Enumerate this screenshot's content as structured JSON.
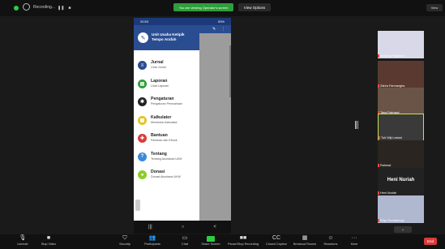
{
  "topbar": {
    "recording_label": "Recording...",
    "pause_icon": "pause-icon",
    "stop_icon": "stop-icon",
    "share_banner": "You are viewing Operator's screen",
    "view_options": "View Options",
    "view_button": "View"
  },
  "phone": {
    "status_time": "20:53",
    "status_right": "53%",
    "drawer": {
      "title": "Unit Usaha Ketipik Tempo Arafah",
      "items": [
        {
          "title": "Jurnal",
          "sub": "Lihat Jurnal",
          "color": "#2a4d92",
          "icon": "journal-icon",
          "glyph": "≡"
        },
        {
          "title": "Laporan",
          "sub": "Lihat Laporan",
          "color": "#2e9e3b",
          "icon": "report-icon",
          "glyph": "▤"
        },
        {
          "title": "Pengaturan",
          "sub": "Pengaturan Perusahaan",
          "color": "#222222",
          "icon": "settings-icon",
          "glyph": "✱"
        },
        {
          "title": "Kalkulator",
          "sub": "Membuka Kalkulator",
          "color": "#e8c21d",
          "icon": "calculator-icon",
          "glyph": "▦"
        },
        {
          "title": "Bantuan",
          "sub": "Panduan dan Ebook",
          "color": "#d93b3b",
          "icon": "help-icon",
          "glyph": "✚"
        },
        {
          "title": "Tentang",
          "sub": "Tentang Akuntansi UKM",
          "color": "#3a8ad8",
          "icon": "about-icon",
          "glyph": "?"
        },
        {
          "title": "Donasi",
          "sub": "Donasi Akuntansi UKM",
          "color": "#8ecb2c",
          "icon": "donate-icon",
          "glyph": "●"
        }
      ]
    },
    "nav": {
      "recent": "|||",
      "home": "○",
      "back": "<"
    }
  },
  "gallery": {
    "tiles": [
      {
        "name": "Andang Pratamuri",
        "bg": "#d8d8e8"
      },
      {
        "name": "Zahra Farmangha",
        "bg": "#5a3a30"
      },
      {
        "name": "Tasa Fatmawi",
        "bg": "#6a5448"
      },
      {
        "name": "Tuti Wiji Lestari",
        "bg": "#3a3a3a"
      },
      {
        "name": "Rahmat",
        "bg": "#2a2520"
      },
      {
        "name": "Heni Nuriah",
        "bg": "#222222",
        "big": "Heni Nuriah"
      },
      {
        "name": "Priyo Purwatmojo",
        "bg": "#b0b8d0"
      }
    ],
    "pager": "⌄"
  },
  "toolbar": {
    "buttons": [
      {
        "label": "Unmute",
        "icon": "mic-off-icon",
        "glyph": "🎙"
      },
      {
        "label": "Stop Video",
        "icon": "video-icon",
        "glyph": "■"
      },
      {
        "label": "Security",
        "icon": "shield-icon",
        "glyph": "⛉"
      },
      {
        "label": "Participants",
        "icon": "participants-icon",
        "glyph": "👥"
      },
      {
        "label": "Chat",
        "icon": "chat-icon",
        "glyph": "▭"
      },
      {
        "label": "Share Screen",
        "icon": "share-icon",
        "glyph": ""
      },
      {
        "label": "Pause/Stop Recording",
        "icon": "recording-icon",
        "glyph": "■■"
      },
      {
        "label": "Closed Caption",
        "icon": "cc-icon",
        "glyph": "CC"
      },
      {
        "label": "Breakout Rooms",
        "icon": "breakout-icon",
        "glyph": "▦"
      },
      {
        "label": "Reactions",
        "icon": "reaction-icon",
        "glyph": "☺"
      },
      {
        "label": "More",
        "icon": "more-icon",
        "glyph": "···"
      }
    ],
    "end": "End"
  }
}
